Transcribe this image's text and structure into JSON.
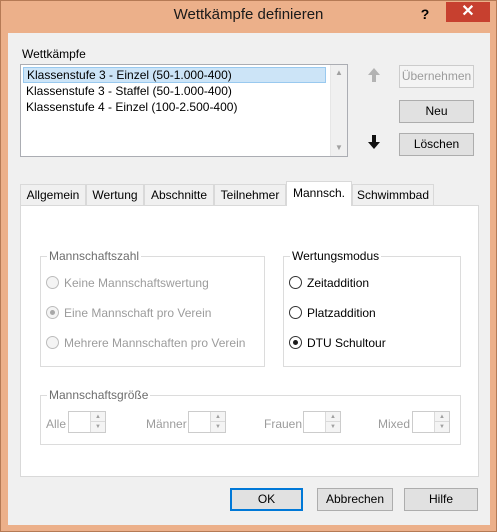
{
  "window": {
    "title": "Wettkämpfe definieren",
    "help_label": "?",
    "close_label": "✕"
  },
  "competitions": {
    "label": "Wettkämpfe",
    "items": [
      "Klassenstufe 3 - Einzel (50-1.000-400)",
      "Klassenstufe 3 - Staffel (50-1.000-400)",
      "Klassenstufe 4 - Einzel (100-2.500-400)"
    ],
    "selected_index": 0
  },
  "actions": {
    "move_up_icon": "up-arrow",
    "move_down_icon": "down-arrow",
    "apply": "Übernehmen",
    "new": "Neu",
    "delete": "Löschen"
  },
  "tabs": [
    "Allgemein",
    "Wertung",
    "Abschnitte",
    "Teilnehmer",
    "Mannsch.",
    "Schwimmbad"
  ],
  "active_tab": "Mannsch.",
  "team_count": {
    "title": "Mannschaftszahl",
    "options": [
      "Keine Mannschaftswertung",
      "Eine Mannschaft pro Verein",
      "Mehrere Mannschaften pro Verein"
    ],
    "selected": "Eine Mannschaft pro Verein"
  },
  "scoring_mode": {
    "title": "Wertungsmodus",
    "options": [
      "Zeitaddition",
      "Platzaddition",
      "DTU Schultour"
    ],
    "selected": "DTU Schultour"
  },
  "team_size": {
    "title": "Mannschaftsgröße",
    "fields": [
      {
        "label": "Alle",
        "value": ""
      },
      {
        "label": "Männer",
        "value": ""
      },
      {
        "label": "Frauen",
        "value": ""
      },
      {
        "label": "Mixed",
        "value": ""
      }
    ]
  },
  "footer": {
    "ok": "OK",
    "cancel": "Abbrechen",
    "help": "Hilfe"
  }
}
